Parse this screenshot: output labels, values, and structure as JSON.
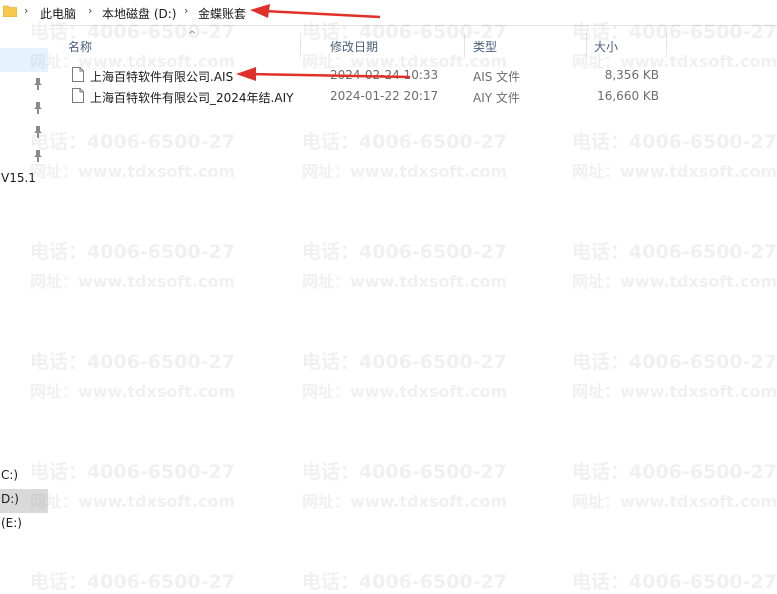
{
  "breadcrumb": {
    "items": [
      "此电脑",
      "本地磁盘 (D:)",
      "金蝶账套"
    ]
  },
  "columns": {
    "name": "名称",
    "date": "修改日期",
    "type": "类型",
    "size": "大小"
  },
  "files": [
    {
      "name": "上海百特软件有限公司.AIS",
      "date": "2024-02-24 10:33",
      "type": "AIS 文件",
      "size": "8,356 KB"
    },
    {
      "name": "上海百特软件有限公司_2024年结.AIY",
      "date": "2024-01-22 20:17",
      "type": "AIY 文件",
      "size": "16,660 KB"
    }
  ],
  "nav": {
    "version_label": "V15.1",
    "drives": [
      "C:)",
      "D:)",
      "(E:)"
    ]
  },
  "watermark": {
    "phone": "电话：4006-6500-27",
    "web": "网址：www.tdxsoft.com"
  },
  "colors": {
    "accent_arrow": "#e0302a",
    "selected_nav": "#e5f3ff",
    "header_text": "#4c607a"
  },
  "icons": {
    "folder": "folder-icon",
    "pin": "pin-icon",
    "file": "file-icon",
    "chevron": "chevron-right-icon"
  }
}
